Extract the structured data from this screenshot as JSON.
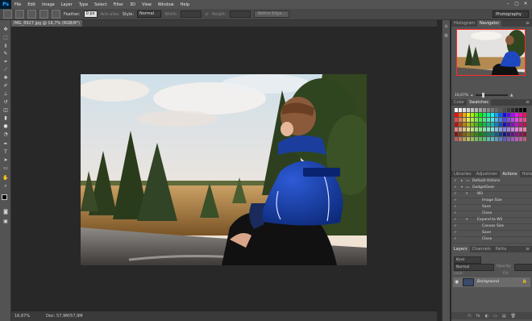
{
  "app": {
    "logo": "Ps",
    "workspace": "Photography"
  },
  "menu": [
    "File",
    "Edit",
    "Image",
    "Layer",
    "Type",
    "Select",
    "Filter",
    "3D",
    "View",
    "Window",
    "Help"
  ],
  "window_controls": [
    "–",
    "▢",
    "✕"
  ],
  "options": {
    "feather_label": "Feather:",
    "feather_value": "0 px",
    "antialias_label": "Anti-alias",
    "style_label": "Style:",
    "style_value": "Normal",
    "width_label": "Width:",
    "height_label": "Height:",
    "refine_label": "Refine Edge..."
  },
  "document": {
    "tab_title": "IMG_8927.jpg @ 16,7% (RGB/8*)"
  },
  "status": {
    "zoom": "16,67%",
    "doc": "Doc: 57,9M/57,9M"
  },
  "panels": {
    "top_tabs": [
      "Histogram",
      "Navigator"
    ],
    "zoom_value": "16,67%",
    "color_tabs": [
      "Color",
      "Swatches"
    ],
    "actions_tabs": [
      "Libraries",
      "Adjustmen",
      "Actions",
      "History"
    ],
    "actions": [
      {
        "label": "Default Actions",
        "level": 0,
        "open": false
      },
      {
        "label": "GadgetGear",
        "level": 0,
        "open": true
      },
      {
        "label": "Wil",
        "level": 1,
        "open": true
      },
      {
        "label": "Image Size",
        "level": 2,
        "open": false
      },
      {
        "label": "Save",
        "level": 2,
        "open": false
      },
      {
        "label": "Close",
        "level": 2,
        "open": false
      },
      {
        "label": "Expand to Wil",
        "level": 1,
        "open": true
      },
      {
        "label": "Canvas Size",
        "level": 2,
        "open": false
      },
      {
        "label": "Save",
        "level": 2,
        "open": false
      },
      {
        "label": "Close",
        "level": 2,
        "open": false
      }
    ],
    "layers_tabs": [
      "Layers",
      "Channels",
      "Paths"
    ],
    "layers_kind": "Kind",
    "blend_mode": "Normal",
    "opacity_label": "Opacity:",
    "lock_label": "Lock:",
    "fill_label": "Fill:",
    "layer_name": "Background",
    "layer_foot": [
      "ⓔ",
      "fx",
      "◐",
      "▭",
      "▤",
      "🗑"
    ]
  },
  "colors": {
    "accent": "#31a8ff",
    "nav_frame": "#ff2a2a"
  }
}
